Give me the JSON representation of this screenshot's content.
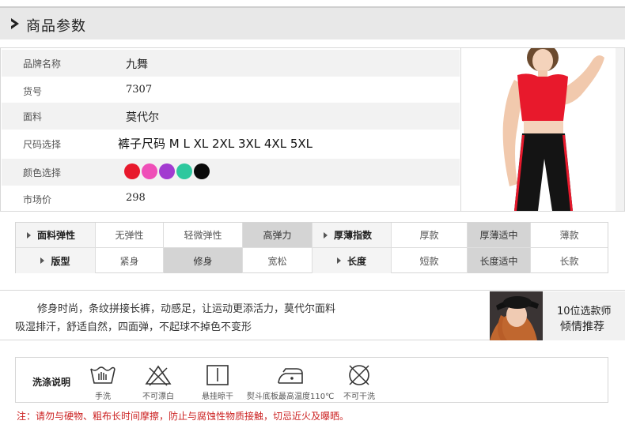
{
  "section": {
    "title": "商品参数"
  },
  "params": [
    {
      "label": "品牌名称",
      "value": "九舞"
    },
    {
      "label": "货号",
      "value": "7307"
    },
    {
      "label": "面料",
      "value": "莫代尔"
    },
    {
      "label": "尺码选择",
      "value": "裤子尺码 M L XL 2XL 3XL 4XL 5XL"
    },
    {
      "label": "颜色选择",
      "value": ""
    },
    {
      "label": "市场价",
      "value": "298"
    }
  ],
  "colors": [
    "#e8192c",
    "#ef4fb8",
    "#a23bd0",
    "#2ec89e",
    "#0a0a0a"
  ],
  "attributes": {
    "fabric_elasticity": {
      "heading": "面料弹性",
      "options": [
        "无弹性",
        "轻微弹性",
        "高弹力"
      ],
      "selected": "高弹力"
    },
    "thickness": {
      "heading": "厚薄指数",
      "options": [
        "厚款",
        "厚薄适中",
        "薄款"
      ],
      "selected": "厚薄适中"
    },
    "fit": {
      "heading": "版型",
      "options": [
        "紧身",
        "修身",
        "宽松"
      ],
      "selected": "修身"
    },
    "length": {
      "heading": "长度",
      "options": [
        "短款",
        "长度适中",
        "长款"
      ],
      "selected": "长度适中"
    }
  },
  "description": {
    "line1": "修身时尚，条纹拼接长裤，动感足，让运动更添活力，莫代尔面料",
    "line2": "吸湿排汗，舒适自然，四面弹，不起球不掉色不变形"
  },
  "designer": {
    "line1": "10位选款师",
    "line2": "倾情推荐"
  },
  "care": {
    "caption": "洗涤说明",
    "items": [
      {
        "icon": "hand-wash-icon",
        "label": "手洗"
      },
      {
        "icon": "no-bleach-icon",
        "label": "不可漂白"
      },
      {
        "icon": "hang-dry-icon",
        "label": "悬挂晾干"
      },
      {
        "icon": "iron-110-icon",
        "label": "熨斗底板最高温度110℃"
      },
      {
        "icon": "no-dry-clean-icon",
        "label": "不可干洗"
      }
    ]
  },
  "note": "注：请勿与硬物、粗布长时间摩擦，防止与腐蚀性物质接触，切忌近火及曝晒。"
}
